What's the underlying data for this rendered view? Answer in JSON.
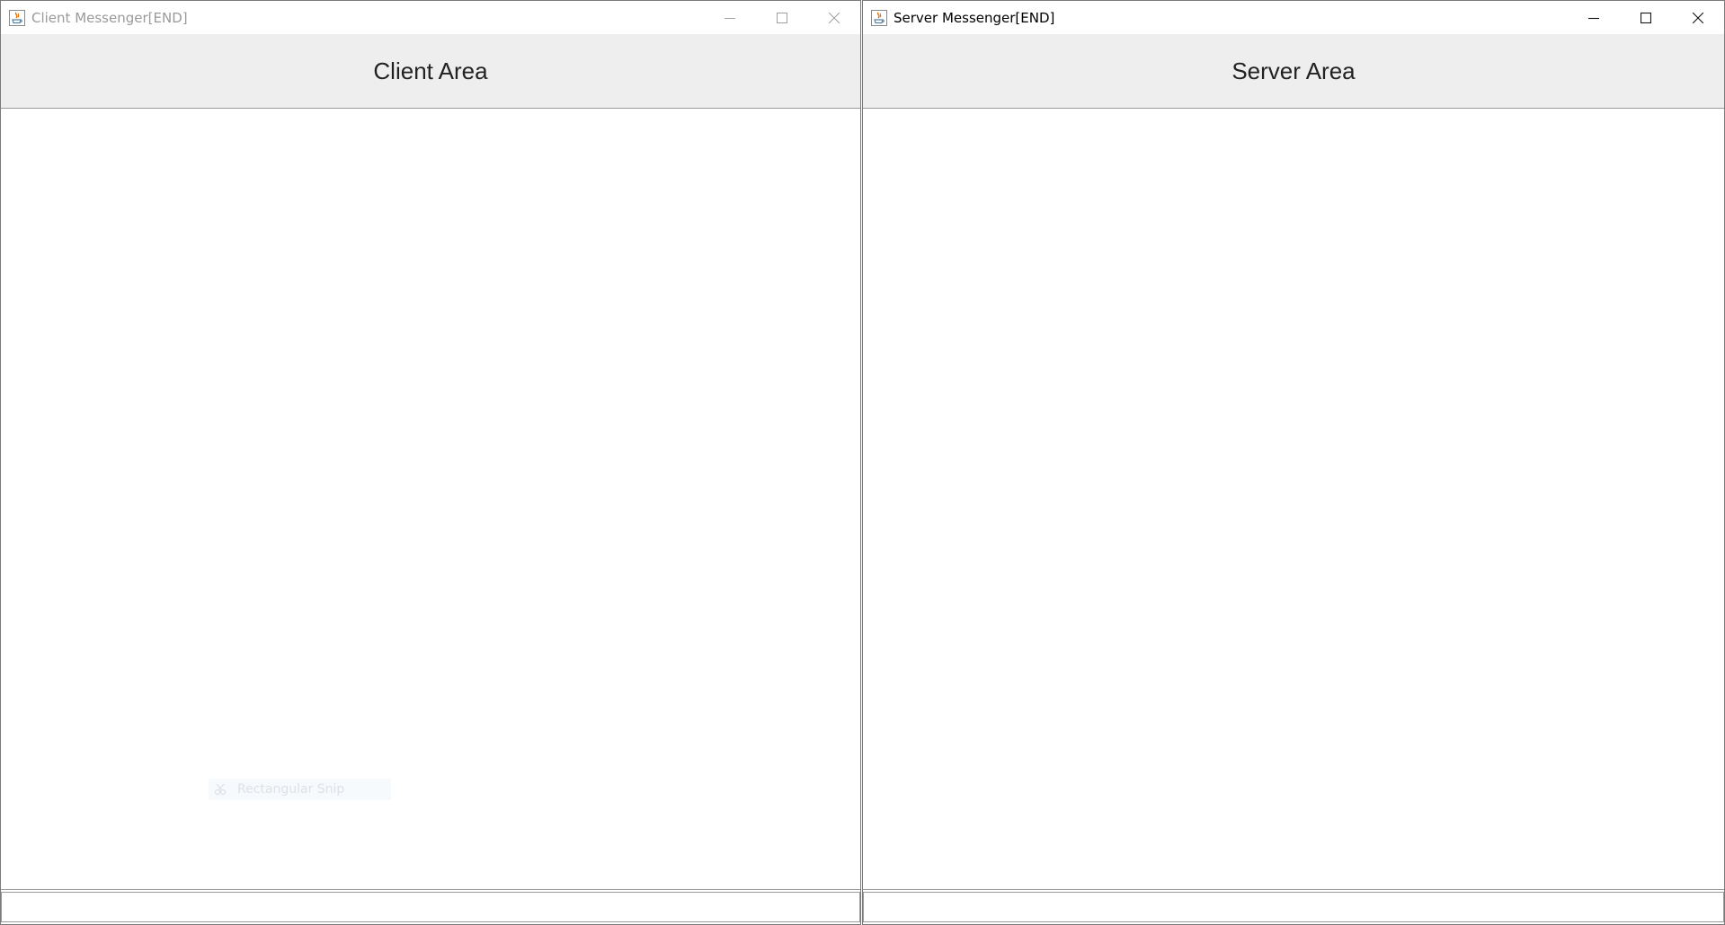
{
  "client_window": {
    "title": "Client Messenger[END]",
    "active": false,
    "header_label": "Client Area",
    "input_value": "",
    "overlay": {
      "label": "Rectangular Snip",
      "icon": "scissors-icon"
    }
  },
  "server_window": {
    "title": "Server Messenger[END]",
    "active": true,
    "header_label": "Server Area",
    "input_value": ""
  },
  "title_buttons": {
    "minimize": "minimize-icon",
    "maximize": "maximize-icon",
    "close": "close-icon"
  },
  "colors": {
    "header_bg": "#eeeeee",
    "inactive_title": "#9a9a9a",
    "active_title": "#000000",
    "java_icon_orange": "#e76f00",
    "java_icon_blue": "#5382a1"
  }
}
